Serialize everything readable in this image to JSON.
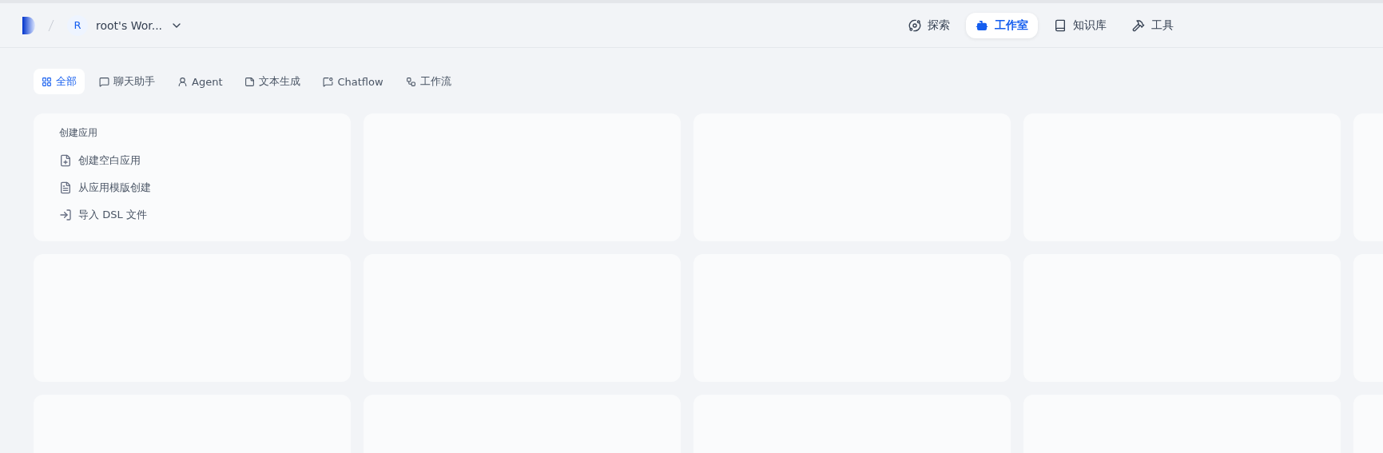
{
  "header": {
    "workspace": {
      "initial": "R",
      "name": "root's Wor..."
    },
    "nav": [
      {
        "label": "探索",
        "selected": false
      },
      {
        "label": "工作室",
        "selected": true
      },
      {
        "label": "知识库",
        "selected": false
      },
      {
        "label": "工具",
        "selected": false
      }
    ]
  },
  "categories": [
    {
      "label": "全部",
      "selected": true
    },
    {
      "label": "聊天助手",
      "selected": false
    },
    {
      "label": "Agent",
      "selected": false
    },
    {
      "label": "文本生成",
      "selected": false
    },
    {
      "label": "Chatflow",
      "selected": false
    },
    {
      "label": "工作流",
      "selected": false
    }
  ],
  "create_card": {
    "title": "创建应用",
    "actions": [
      "创建空白应用",
      "从应用模版创建",
      "导入 DSL 文件"
    ]
  },
  "placeholder_cards": [
    {
      "kind": "skeleton"
    },
    {
      "kind": "skeleton"
    },
    {
      "kind": "skeleton"
    },
    {
      "kind": "skeleton"
    },
    {
      "kind": "skeleton"
    },
    {
      "kind": "skeleton"
    },
    {
      "kind": "skeleton"
    },
    {
      "kind": "skeleton"
    },
    {
      "kind": "skeleton"
    },
    {
      "kind": "skeleton"
    },
    {
      "kind": "skeleton"
    },
    {
      "kind": "skeleton"
    },
    {
      "kind": "skeleton"
    },
    {
      "kind": "skeleton"
    }
  ]
}
